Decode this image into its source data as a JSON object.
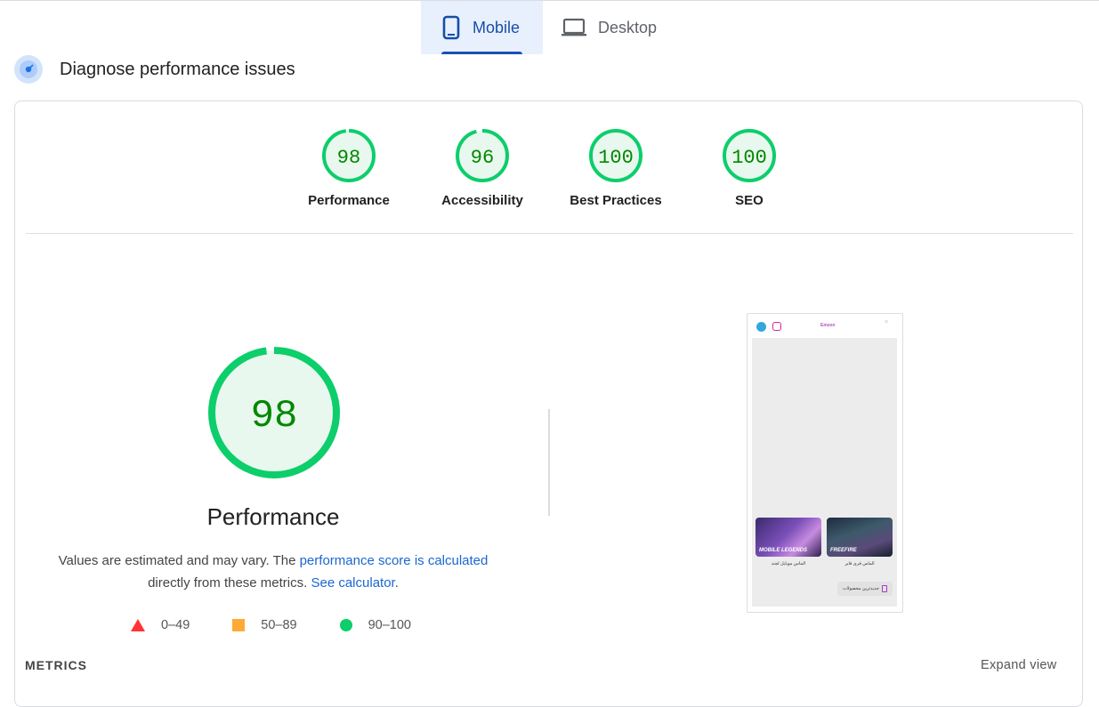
{
  "tabs": [
    {
      "label": "Mobile",
      "icon": "smartphone-icon",
      "selected": true
    },
    {
      "label": "Desktop",
      "icon": "laptop-icon",
      "selected": false
    }
  ],
  "heading": {
    "title": "Diagnose performance issues",
    "icon": "lighthouse-icon"
  },
  "categories": [
    {
      "score": "98",
      "label": "Performance",
      "value": 98
    },
    {
      "score": "96",
      "label": "Accessibility",
      "value": 96
    },
    {
      "score": "100",
      "label": "Best Practices",
      "value": 100
    },
    {
      "score": "100",
      "label": "SEO",
      "value": 100
    }
  ],
  "main_gauge": {
    "score": "98",
    "value": 98,
    "title": "Performance"
  },
  "description": {
    "part1": "Values are estimated and may vary. The ",
    "link1": "performance score is calculated",
    "part2": "directly from these metrics. ",
    "link2": "See calculator",
    "part3": "."
  },
  "legend": [
    {
      "shape": "triangle",
      "range": "0–49",
      "color": "#ff3333"
    },
    {
      "shape": "square",
      "range": "50–89",
      "color": "#ffaa33"
    },
    {
      "shape": "circle",
      "range": "90–100",
      "color": "#0cce6b"
    }
  ],
  "preview": {
    "logo_text": "Emzon",
    "card1_text": "MOBILE LEGENDS",
    "card2_text": "FREEFIRE",
    "card1_caption": "الماس موبایل لجند",
    "card2_caption": "الماس فری فایر",
    "button_label": "جدیدترین محصولات"
  },
  "metrics": {
    "label": "METRICS",
    "expand": "Expand view"
  },
  "colors": {
    "pass": "#0cce6b",
    "pass_bg": "#e9f8ee",
    "pass_text": "#008800",
    "accent": "#174ea6"
  }
}
